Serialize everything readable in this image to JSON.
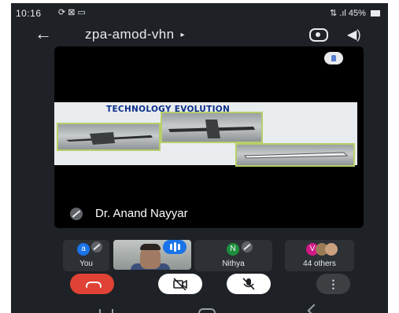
{
  "status_bar": {
    "time": "10:16",
    "notification_icons": "⟳ ⊠ ▭",
    "network": "⇅ .ıl",
    "battery": "45%"
  },
  "top_bar": {
    "meeting_title": "zpa-amod-vhn",
    "title_caret": "▸"
  },
  "main_video": {
    "slide_title": "TECHNOLOGY EVOLUTION",
    "presenter_name": "Dr. Anand Nayyar"
  },
  "participants": [
    {
      "label": "You",
      "avatar_letter": "a",
      "avatar_color": "#1a73e8",
      "muted": true
    },
    {
      "label": "",
      "type": "video",
      "speaking": true
    },
    {
      "label": "Nithya",
      "avatar_letter": "N",
      "avatar_color": "#1e8e3e",
      "muted": true
    },
    {
      "label": "44 others",
      "avatar_letter": "V",
      "avatar_color": "#d01884"
    }
  ],
  "controls": {
    "end_call_color": "#e04335",
    "more_label": "⋮"
  },
  "colors": {
    "background": "#1e2226",
    "tile": "#2d3136",
    "slide_title": "#0a2f8a",
    "photo_border": "#b7cf6a"
  }
}
